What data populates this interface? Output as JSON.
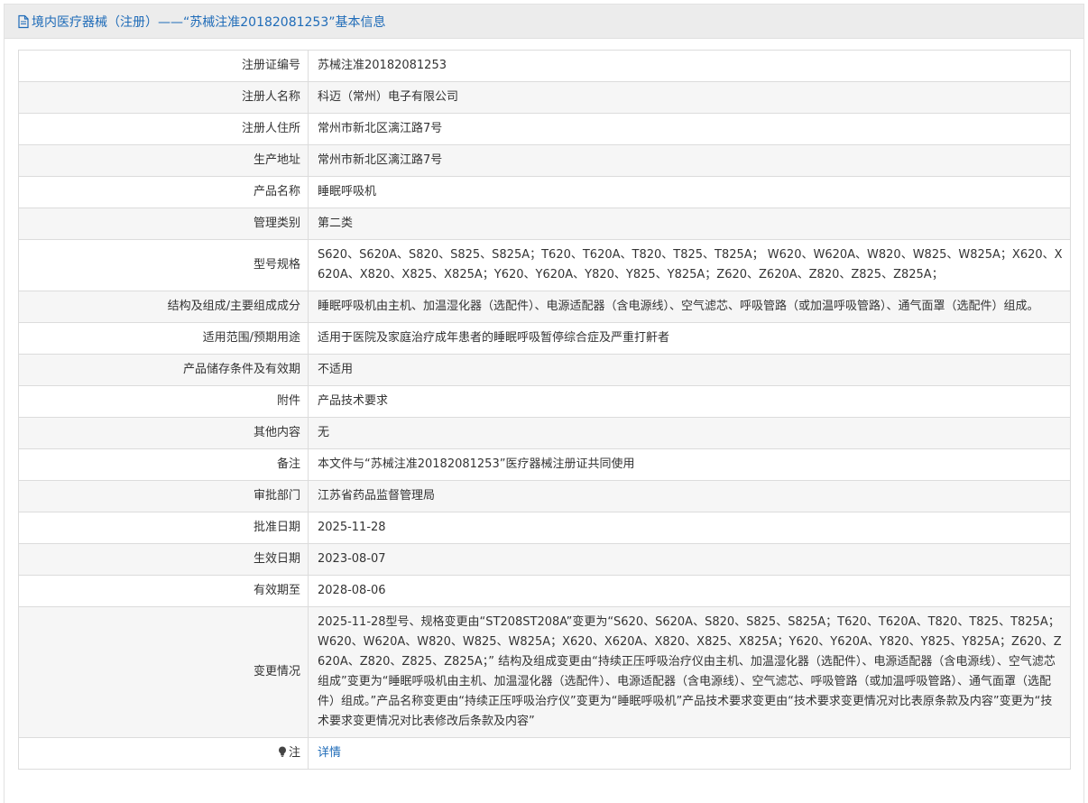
{
  "header": {
    "title": "境内医疗器械（注册）——“苏械注准20182081253”基本信息",
    "accent_color": "#1e6bb8",
    "icon": "document-icon"
  },
  "fields": [
    {
      "label": "注册证编号",
      "value": "苏械注准20182081253"
    },
    {
      "label": "注册人名称",
      "value": "科迈（常州）电子有限公司"
    },
    {
      "label": "注册人住所",
      "value": "常州市新北区漓江路7号"
    },
    {
      "label": "生产地址",
      "value": "常州市新北区漓江路7号"
    },
    {
      "label": "产品名称",
      "value": "睡眠呼吸机"
    },
    {
      "label": "管理类别",
      "value": "第二类"
    },
    {
      "label": "型号规格",
      "value": "S620、S620A、S820、S825、S825A；T620、T620A、T820、T825、T825A； W620、W620A、W820、W825、W825A；X620、X620A、X820、X825、X825A；Y620、Y620A、Y820、Y825、Y825A；Z620、Z620A、Z820、Z825、Z825A；"
    },
    {
      "label": "结构及组成/主要组成成分",
      "value": "睡眠呼吸机由主机、加温湿化器（选配件）、电源适配器（含电源线）、空气滤芯、呼吸管路（或加温呼吸管路）、通气面罩（选配件）组成。"
    },
    {
      "label": "适用范围/预期用途",
      "value": "适用于医院及家庭治疗成年患者的睡眠呼吸暂停综合症及严重打鼾者"
    },
    {
      "label": "产品储存条件及有效期",
      "value": "不适用"
    },
    {
      "label": "附件",
      "value": "产品技术要求"
    },
    {
      "label": "其他内容",
      "value": "无"
    },
    {
      "label": "备注",
      "value": "本文件与“苏械注准20182081253”医疗器械注册证共同使用"
    },
    {
      "label": "审批部门",
      "value": "江苏省药品监督管理局"
    },
    {
      "label": "批准日期",
      "value": "2025-11-28"
    },
    {
      "label": "生效日期",
      "value": "2023-08-07"
    },
    {
      "label": "有效期至",
      "value": "2028-08-06"
    },
    {
      "label": "变更情况",
      "value": "2025-11-28型号、规格变更由“ST208ST208A”变更为“S620、S620A、S820、S825、S825A；T620、T620A、T820、T825、T825A；W620、W620A、W820、W825、W825A；X620、X620A、X820、X825、X825A；Y620、Y620A、Y820、Y825、Y825A；Z620、Z620A、Z820、Z825、Z825A；” 结构及组成变更由“持续正压呼吸治疗仪由主机、加温湿化器（选配件）、电源适配器（含电源线）、空气滤芯组成”变更为“睡眠呼吸机由主机、加温湿化器（选配件）、电源适配器（含电源线）、空气滤芯、呼吸管路（或加温呼吸管路）、通气面罩（选配件）组成。”产品名称变更由“持续正压呼吸治疗仪”变更为“睡眠呼吸机”产品技术要求变更由“技术要求变更情况对比表原条款及内容”变更为“技术要求变更情况对比表修改后条款及内容”"
    }
  ],
  "note": {
    "label": "注",
    "icon": "lightbulb-icon",
    "link_text": "详情"
  }
}
